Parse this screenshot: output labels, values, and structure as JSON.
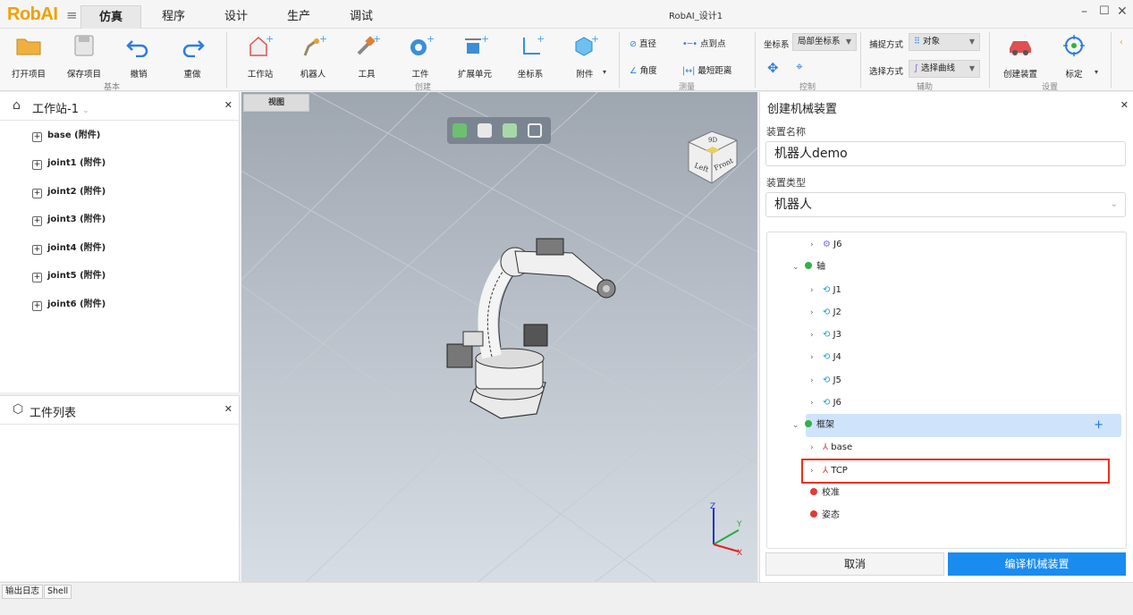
{
  "app": {
    "logo": "RobAI",
    "window_title": "RobAI_设计1"
  },
  "menu_tabs": [
    "仿真",
    "程序",
    "设计",
    "生产",
    "调试"
  ],
  "ribbon": {
    "basic": {
      "buttons": [
        "打开项目",
        "保存项目",
        "撤销",
        "重做"
      ],
      "group": "基本"
    },
    "create": {
      "buttons": [
        "工作站",
        "机器人",
        "工具",
        "工件",
        "扩展单元",
        "坐标系",
        "附件"
      ],
      "group": "创建"
    },
    "measure": {
      "items": [
        "直径",
        "点到点",
        "角度",
        "最短距离"
      ],
      "group": "测量"
    },
    "control": {
      "coord_label": "坐标系",
      "coord_value": "局部坐标系",
      "group": "控制"
    },
    "aux": {
      "capture_label": "捕捉方式",
      "capture_value": "对象",
      "select_label": "选择方式",
      "select_value": "选择曲线",
      "group": "辅助"
    },
    "settings": {
      "buttons": [
        "创建装置",
        "标定"
      ],
      "group": "设置"
    }
  },
  "left_top": {
    "title": "工作站-1",
    "items": [
      "base (附件)",
      "joint1 (附件)",
      "joint2 (附件)",
      "joint3 (附件)",
      "joint4 (附件)",
      "joint5 (附件)",
      "joint6 (附件)"
    ]
  },
  "left_bottom": {
    "title": "工件列表"
  },
  "viewport": {
    "tab": "视图",
    "cube_labels": [
      "Left",
      "Front",
      "9D"
    ],
    "axes": [
      "Z",
      "Y",
      "X"
    ]
  },
  "right_panel": {
    "title": "创建机械装置",
    "name_label": "装置名称",
    "name_value": "机器人demo",
    "type_label": "装置类型",
    "type_value": "机器人",
    "tree": {
      "top_j6": "J6",
      "axes_label": "轴",
      "axes": [
        "J1",
        "J2",
        "J3",
        "J4",
        "J5",
        "J6"
      ],
      "frame_label": "框架",
      "frames": [
        "base",
        "TCP"
      ],
      "calib_label": "校准",
      "pose_label": "姿态"
    },
    "cancel": "取消",
    "compile": "编译机械装置"
  },
  "bottom_tabs": [
    "输出日志",
    "Shell"
  ],
  "colors": {
    "accent": "#1a8cf0",
    "logo": "#f0a000",
    "highlight": "#e8321a",
    "green": "#2fb344",
    "red": "#e53935"
  }
}
